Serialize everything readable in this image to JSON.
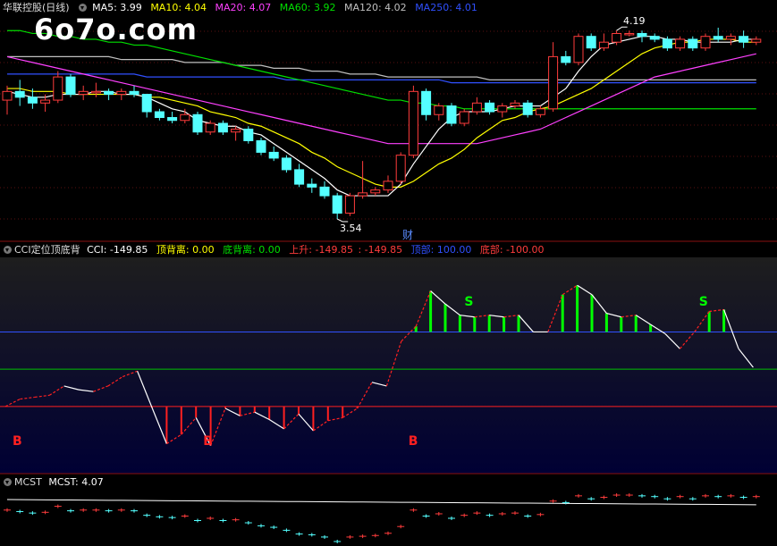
{
  "watermark": "6o7o.com",
  "main_header": {
    "title": "华联控股(日线)",
    "ma5": "MA5: 3.99",
    "ma10": "MA10: 4.04",
    "ma20": "MA20: 4.07",
    "ma60": "MA60: 3.92",
    "ma120": "MA120: 4.02",
    "ma250": "MA250: 4.01"
  },
  "cci_header": {
    "title": "CCI定位顶底背",
    "cci": "CCI: -149.85",
    "top_div": "顶背离: 0.00",
    "bottom_div": "底背离: 0.00",
    "up": "上升: -149.85",
    "up2": ": -149.85",
    "top": "顶部: 100.00",
    "bottom": "底部: -100.00"
  },
  "mcst_header": {
    "title": "MCST",
    "value": "MCST: 4.07"
  },
  "annotations": {
    "high": "4.19",
    "low": "3.54",
    "cai": "财",
    "b": "B",
    "s": "S"
  },
  "colors": {
    "up": "#ff3c3c",
    "down": "#54ffff",
    "ma5": "#ffffff",
    "ma10": "#ffff00",
    "ma20": "#ff40ff",
    "ma60": "#00e000",
    "ma120": "#c0c0c0",
    "ma250": "#3050ff"
  },
  "chart_data": [
    {
      "type": "candlestick",
      "title": "华联控股(日线)",
      "ohlc": [
        [
          3.95,
          4.0,
          3.9,
          3.98
        ],
        [
          3.98,
          4.02,
          3.93,
          3.96
        ],
        [
          3.96,
          3.99,
          3.92,
          3.94
        ],
        [
          3.94,
          3.97,
          3.91,
          3.95
        ],
        [
          3.95,
          4.05,
          3.94,
          4.03
        ],
        [
          4.03,
          4.04,
          3.96,
          3.97
        ],
        [
          3.97,
          4.0,
          3.95,
          3.98
        ],
        [
          3.98,
          4.01,
          3.96,
          3.98
        ],
        [
          3.98,
          3.99,
          3.95,
          3.97
        ],
        [
          3.97,
          3.99,
          3.95,
          3.98
        ],
        [
          3.98,
          4.0,
          3.96,
          3.97
        ],
        [
          3.97,
          3.97,
          3.89,
          3.91
        ],
        [
          3.91,
          3.92,
          3.88,
          3.89
        ],
        [
          3.89,
          3.91,
          3.87,
          3.88
        ],
        [
          3.88,
          3.92,
          3.87,
          3.9
        ],
        [
          3.9,
          3.91,
          3.83,
          3.84
        ],
        [
          3.84,
          3.88,
          3.83,
          3.87
        ],
        [
          3.87,
          3.88,
          3.83,
          3.84
        ],
        [
          3.84,
          3.86,
          3.81,
          3.85
        ],
        [
          3.85,
          3.86,
          3.8,
          3.81
        ],
        [
          3.81,
          3.82,
          3.76,
          3.77
        ],
        [
          3.77,
          3.79,
          3.74,
          3.75
        ],
        [
          3.75,
          3.76,
          3.7,
          3.71
        ],
        [
          3.71,
          3.73,
          3.65,
          3.66
        ],
        [
          3.66,
          3.68,
          3.63,
          3.65
        ],
        [
          3.65,
          3.67,
          3.61,
          3.62
        ],
        [
          3.62,
          3.63,
          3.54,
          3.56
        ],
        [
          3.56,
          3.63,
          3.55,
          3.62
        ],
        [
          3.62,
          3.74,
          3.61,
          3.63
        ],
        [
          3.63,
          3.65,
          3.62,
          3.64
        ],
        [
          3.64,
          3.69,
          3.63,
          3.67
        ],
        [
          3.67,
          3.77,
          3.66,
          3.76
        ],
        [
          3.76,
          4.0,
          3.75,
          3.98
        ],
        [
          3.98,
          3.99,
          3.88,
          3.9
        ],
        [
          3.9,
          3.94,
          3.88,
          3.93
        ],
        [
          3.93,
          3.94,
          3.86,
          3.87
        ],
        [
          3.87,
          3.92,
          3.86,
          3.91
        ],
        [
          3.91,
          3.96,
          3.9,
          3.94
        ],
        [
          3.94,
          3.95,
          3.9,
          3.91
        ],
        [
          3.91,
          3.94,
          3.89,
          3.93
        ],
        [
          3.93,
          3.95,
          3.92,
          3.94
        ],
        [
          3.94,
          3.95,
          3.89,
          3.9
        ],
        [
          3.9,
          3.93,
          3.89,
          3.92
        ],
        [
          3.92,
          4.15,
          3.91,
          4.1
        ],
        [
          4.1,
          4.12,
          4.07,
          4.08
        ],
        [
          4.08,
          4.18,
          4.07,
          4.17
        ],
        [
          4.17,
          4.18,
          4.12,
          4.13
        ],
        [
          4.13,
          4.18,
          4.12,
          4.15
        ],
        [
          4.15,
          4.19,
          4.14,
          4.18
        ],
        [
          4.18,
          4.19,
          4.17,
          4.18
        ],
        [
          4.18,
          4.19,
          4.15,
          4.17
        ],
        [
          4.17,
          4.18,
          4.15,
          4.16
        ],
        [
          4.16,
          4.17,
          4.12,
          4.13
        ],
        [
          4.13,
          4.17,
          4.12,
          4.16
        ],
        [
          4.16,
          4.17,
          4.12,
          4.13
        ],
        [
          4.13,
          4.18,
          4.12,
          4.17
        ],
        [
          4.17,
          4.2,
          4.15,
          4.16
        ],
        [
          4.16,
          4.18,
          4.14,
          4.17
        ],
        [
          4.17,
          4.19,
          4.13,
          4.15
        ],
        [
          4.15,
          4.17,
          4.14,
          4.16
        ]
      ],
      "ma": {
        "ma5": [
          3.98,
          3.97,
          3.96,
          3.96,
          3.97,
          3.97,
          3.97,
          3.98,
          3.98,
          3.97,
          3.97,
          3.96,
          3.94,
          3.92,
          3.91,
          3.88,
          3.87,
          3.86,
          3.86,
          3.84,
          3.83,
          3.8,
          3.77,
          3.74,
          3.71,
          3.68,
          3.64,
          3.62,
          3.62,
          3.62,
          3.62,
          3.66,
          3.73,
          3.79,
          3.85,
          3.89,
          3.91,
          3.91,
          3.91,
          3.92,
          3.93,
          3.93,
          3.93,
          3.96,
          3.99,
          4.05,
          4.1,
          4.14,
          4.15,
          4.16,
          4.17,
          4.17,
          4.16,
          4.16,
          4.15,
          4.15,
          4.15,
          4.15,
          4.16,
          4.16
        ],
        "ma10": [
          3.99,
          3.99,
          3.98,
          3.98,
          3.98,
          3.97,
          3.97,
          3.97,
          3.97,
          3.97,
          3.97,
          3.96,
          3.96,
          3.95,
          3.94,
          3.93,
          3.91,
          3.9,
          3.89,
          3.87,
          3.86,
          3.84,
          3.82,
          3.8,
          3.77,
          3.75,
          3.72,
          3.7,
          3.68,
          3.66,
          3.65,
          3.65,
          3.67,
          3.7,
          3.73,
          3.75,
          3.78,
          3.82,
          3.85,
          3.88,
          3.89,
          3.91,
          3.92,
          3.93,
          3.95,
          3.97,
          3.99,
          4.02,
          4.05,
          4.08,
          4.11,
          4.13,
          4.14,
          4.15,
          4.15,
          4.16,
          4.16,
          4.16,
          4.15,
          4.15
        ],
        "ma20": [
          4.1,
          4.09,
          4.08,
          4.07,
          4.06,
          4.05,
          4.04,
          4.03,
          4.02,
          4.01,
          4.0,
          3.99,
          3.98,
          3.97,
          3.96,
          3.95,
          3.94,
          3.93,
          3.92,
          3.91,
          3.9,
          3.89,
          3.88,
          3.87,
          3.86,
          3.85,
          3.84,
          3.83,
          3.82,
          3.81,
          3.8,
          3.8,
          3.8,
          3.8,
          3.8,
          3.8,
          3.8,
          3.8,
          3.81,
          3.82,
          3.83,
          3.84,
          3.85,
          3.87,
          3.89,
          3.91,
          3.93,
          3.95,
          3.97,
          3.99,
          4.01,
          4.03,
          4.04,
          4.05,
          4.06,
          4.07,
          4.08,
          4.09,
          4.1,
          4.11
        ],
        "ma60": [
          4.19,
          4.19,
          4.18,
          4.18,
          4.17,
          4.17,
          4.16,
          4.16,
          4.15,
          4.15,
          4.14,
          4.14,
          4.13,
          4.12,
          4.11,
          4.1,
          4.09,
          4.08,
          4.07,
          4.06,
          4.05,
          4.04,
          4.03,
          4.02,
          4.01,
          4.0,
          3.99,
          3.98,
          3.97,
          3.96,
          3.95,
          3.95,
          3.94,
          3.94,
          3.93,
          3.93,
          3.92,
          3.92,
          3.92,
          3.92,
          3.92,
          3.92,
          3.92,
          3.92,
          3.92,
          3.92,
          3.92,
          3.92,
          3.92,
          3.92,
          3.92,
          3.92,
          3.92,
          3.92,
          3.92,
          3.92,
          3.92,
          3.92,
          3.92,
          3.92
        ],
        "ma120": [
          4.1,
          4.1,
          4.1,
          4.1,
          4.1,
          4.1,
          4.1,
          4.1,
          4.1,
          4.09,
          4.09,
          4.09,
          4.09,
          4.09,
          4.08,
          4.08,
          4.08,
          4.08,
          4.07,
          4.07,
          4.07,
          4.06,
          4.06,
          4.06,
          4.05,
          4.05,
          4.05,
          4.04,
          4.04,
          4.04,
          4.03,
          4.03,
          4.03,
          4.03,
          4.03,
          4.03,
          4.03,
          4.03,
          4.02,
          4.02,
          4.02,
          4.02,
          4.02,
          4.02,
          4.02,
          4.02,
          4.02,
          4.02,
          4.02,
          4.02,
          4.02,
          4.02,
          4.02,
          4.02,
          4.02,
          4.02,
          4.02,
          4.02,
          4.02,
          4.02
        ],
        "ma250": [
          4.04,
          4.04,
          4.04,
          4.04,
          4.04,
          4.04,
          4.04,
          4.04,
          4.04,
          4.04,
          4.04,
          4.03,
          4.03,
          4.03,
          4.03,
          4.03,
          4.03,
          4.03,
          4.03,
          4.03,
          4.03,
          4.03,
          4.02,
          4.02,
          4.02,
          4.02,
          4.02,
          4.02,
          4.02,
          4.02,
          4.02,
          4.02,
          4.02,
          4.02,
          4.02,
          4.01,
          4.01,
          4.01,
          4.01,
          4.01,
          4.01,
          4.01,
          4.01,
          4.01,
          4.01,
          4.01,
          4.01,
          4.01,
          4.01,
          4.01,
          4.01,
          4.01,
          4.01,
          4.01,
          4.01,
          4.01,
          4.01,
          4.01,
          4.01,
          4.01
        ]
      },
      "ylim": [
        3.5,
        4.24
      ]
    },
    {
      "type": "line",
      "title": "CCI定位顶底背",
      "cci": [
        -100,
        -80,
        -75,
        -70,
        -45,
        -55,
        -60,
        -45,
        -20,
        -5,
        -103,
        -200,
        -175,
        -130,
        -205,
        -105,
        -125,
        -115,
        -135,
        -160,
        -120,
        -165,
        -138,
        -130,
        -105,
        -35,
        -45,
        75,
        115,
        210,
        175,
        145,
        140,
        145,
        140,
        145,
        100,
        100,
        200,
        225,
        200,
        150,
        140,
        145,
        120,
        95,
        55,
        100,
        155,
        160,
        55,
        5
      ],
      "levels": {
        "top": 100,
        "zero": 0,
        "bottom": -100
      },
      "buy_markers": [
        0,
        13,
        27
      ],
      "sell_markers": [
        31,
        47,
        57
      ],
      "ylim": [
        -280,
        300
      ]
    },
    {
      "type": "line",
      "title": "MCST",
      "value": 4.07
    }
  ]
}
